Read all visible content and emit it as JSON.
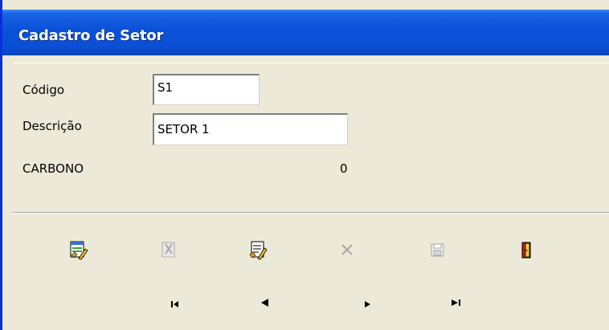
{
  "window": {
    "title": "Cadastro de Setor"
  },
  "form": {
    "codigo_label": "Código",
    "codigo_value": "S1",
    "descricao_label": "Descrição",
    "descricao_value": "SETOR 1",
    "carbono_label": "CARBONO",
    "carbono_value": "0"
  },
  "toolbar": {
    "buttons": [
      {
        "icon": "insert-record-icon",
        "enabled": true
      },
      {
        "icon": "delete-record-icon",
        "enabled": false
      },
      {
        "icon": "edit-record-icon",
        "enabled": true
      },
      {
        "icon": "cancel-x-icon",
        "enabled": false
      },
      {
        "icon": "save-disk-icon",
        "enabled": false
      },
      {
        "icon": "exit-door-icon",
        "enabled": true
      }
    ]
  },
  "navigator": {
    "buttons": [
      {
        "icon": "first-record-icon"
      },
      {
        "icon": "prior-record-icon"
      },
      {
        "icon": "next-record-icon"
      },
      {
        "icon": "last-record-icon"
      }
    ]
  },
  "colors": {
    "title_bar": "#0a50d8",
    "window_face": "#ece9d8",
    "disabled_icon": "#a8a8a8"
  }
}
